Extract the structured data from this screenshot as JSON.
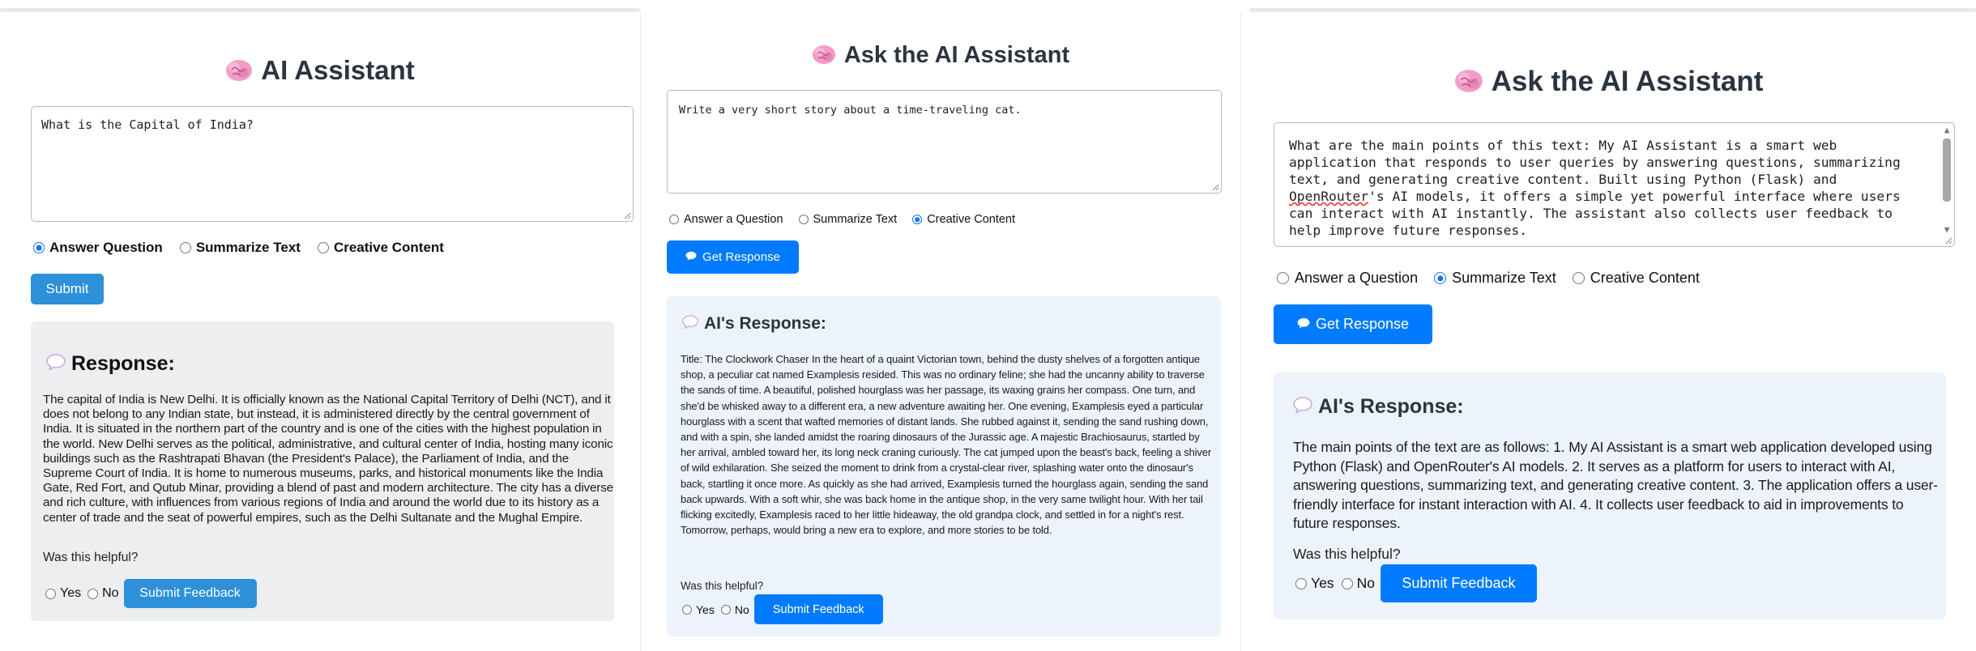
{
  "colors": {
    "accent_blue": "#007bff",
    "submit_blue": "#2d90d9",
    "response_gray": "#eceeef",
    "response_blue": "#edf3fb",
    "title_text": "#2b3440"
  },
  "panel1": {
    "title": "AI Assistant",
    "title_icon": "brain-icon",
    "input_value": "What is the Capital of India?",
    "modes": [
      "Answer Question",
      "Summarize Text",
      "Creative Content"
    ],
    "selected_mode": "Answer Question",
    "submit_label": "Submit",
    "response_icon": "speech-bubble-icon",
    "response_heading": "Response:",
    "response_text": "The capital of India is New Delhi. It is officially known as the National Capital Territory of Delhi (NCT), and it does not belong to any Indian state, but instead, it is administered directly by the central government of India. It is situated in the northern part of the country and is one of the cities with the highest population in the world. New Delhi serves as the political, administrative, and cultural center of India, hosting many iconic buildings such as the Rashtrapati Bhavan (the President's Palace), the Parliament of India, and the Supreme Court of India. It is home to numerous museums, parks, and historical monuments like the India Gate, Red Fort, and Qutub Minar, providing a blend of past and modern architecture. The city has a diverse and rich culture, with influences from various regions of India and around the world due to its history as a center of trade and the seat of powerful empires, such as the Delhi Sultanate and the Mughal Empire.",
    "helpful_q": "Was this helpful?",
    "yes": "Yes",
    "no": "No",
    "feedback_label": "Submit Feedback"
  },
  "panel2": {
    "title": "Ask the AI Assistant",
    "title_icon": "brain-icon",
    "input_value": "Write a very short story about a time-traveling cat.",
    "modes": [
      "Answer a Question",
      "Summarize Text",
      "Creative Content"
    ],
    "selected_mode": "Creative Content",
    "submit_label": "Get Response",
    "response_icon": "speech-bubble-icon",
    "response_heading": "AI's Response:",
    "response_text": "Title: The Clockwork Chaser In the heart of a quaint Victorian town, behind the dusty shelves of a forgotten antique shop, a peculiar cat named Examplesis resided. This was no ordinary feline; she had the uncanny ability to traverse the sands of time. A beautiful, polished hourglass was her passage, its waxing grains her compass. One turn, and she'd be whisked away to a different era, a new adventure awaiting her. One evening, Examplesis eyed a particular hourglass with a scent that wafted memories of distant lands. She rubbed against it, sending the sand rushing down, and with a spin, she landed amidst the roaring dinosaurs of the Jurassic age. A majestic Brachiosaurus, startled by her arrival, ambled toward her, its long neck craning curiously. The cat jumped upon the beast's back, feeling a shiver of wild exhilaration. She seized the moment to drink from a crystal-clear river, splashing water onto the dinosaur's back, startling it once more. As quickly as she had arrived, Examplesis turned the hourglass again, sending the sand back upwards. With a soft whir, she was back home in the antique shop, in the very same twilight hour. With her tail flicking excitedly, Examplesis raced to her little hideaway, the old grandpa clock, and settled in for a night's rest. Tomorrow, perhaps, would bring a new era to explore, and more stories to be told.",
    "helpful_q": "Was this helpful?",
    "yes": "Yes",
    "no": "No",
    "feedback_label": "Submit Feedback"
  },
  "panel3": {
    "title": "Ask the AI Assistant",
    "title_icon": "brain-icon",
    "input_value_pre": "What are the main points of this text: My AI Assistant is a smart web application that responds to user queries by answering questions, summarizing text, and generating creative content. Built using Python (Flask) and ",
    "input_value_misspelled": "OpenRouter",
    "input_value_post": "'s AI models, it offers a simple yet powerful interface where users can interact with AI instantly. The assistant also collects user feedback to help improve future responses.",
    "modes": [
      "Answer a Question",
      "Summarize Text",
      "Creative Content"
    ],
    "selected_mode": "Summarize Text",
    "submit_label": "Get Response",
    "response_icon": "speech-bubble-icon",
    "response_heading": "AI's Response:",
    "response_text": "The main points of the text are as follows: 1. My AI Assistant is a smart web application developed using Python (Flask) and OpenRouter's AI models. 2. It serves as a platform for users to interact with AI, answering questions, summarizing text, and generating creative content. 3. The application offers a user-friendly interface for instant interaction with AI. 4. It collects user feedback to aid in improvements to future responses.",
    "helpful_q": "Was this helpful?",
    "yes": "Yes",
    "no": "No",
    "feedback_label": "Submit Feedback"
  }
}
